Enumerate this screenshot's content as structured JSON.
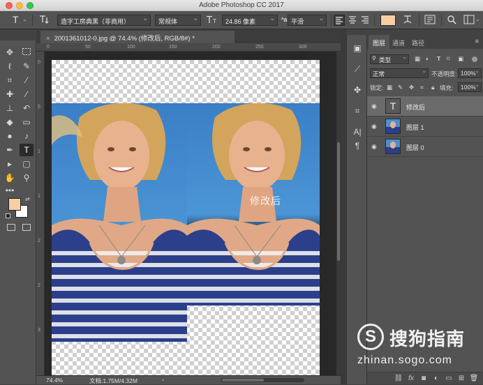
{
  "window": {
    "title": "Adobe Photoshop CC 2017"
  },
  "options_bar": {
    "tool_icon": "type-tool-icon",
    "font_family": "造字工房典黑（非商用）",
    "font_style": "常规体",
    "font_size": "24.86 像素",
    "anti_alias": "平滑",
    "text_color": "#f7cfa4"
  },
  "document_tab": {
    "close_glyph": "×",
    "label": "2001361012-0.jpg @ 74.4% (修改后, RGB/8#) *"
  },
  "canvas": {
    "overlay_text": "修改后"
  },
  "status_bar": {
    "zoom": "74.4%",
    "doc_info": "文档:1.75M/4.32M"
  },
  "toolbox": {
    "foreground_color": "#f7cfa4",
    "background_color": "#ffffff"
  },
  "layers_panel": {
    "tabs": [
      "图层",
      "通道",
      "路径"
    ],
    "filter_kind": "类型",
    "blend_mode": "正常",
    "opacity_label": "不透明度:",
    "opacity_value": "100%",
    "lock_label": "锁定:",
    "fill_label": "填充:",
    "fill_value": "100%",
    "layers": [
      {
        "name": "修改后",
        "kind": "text",
        "selected": true
      },
      {
        "name": "图层 1",
        "kind": "image",
        "selected": false
      },
      {
        "name": "图层 0",
        "kind": "image",
        "selected": false
      }
    ],
    "text_thumb_glyph": "T"
  },
  "watermark": {
    "logo_glyph": "S",
    "brand": "搜狗指南",
    "url": "zhinan.sogo.com"
  }
}
